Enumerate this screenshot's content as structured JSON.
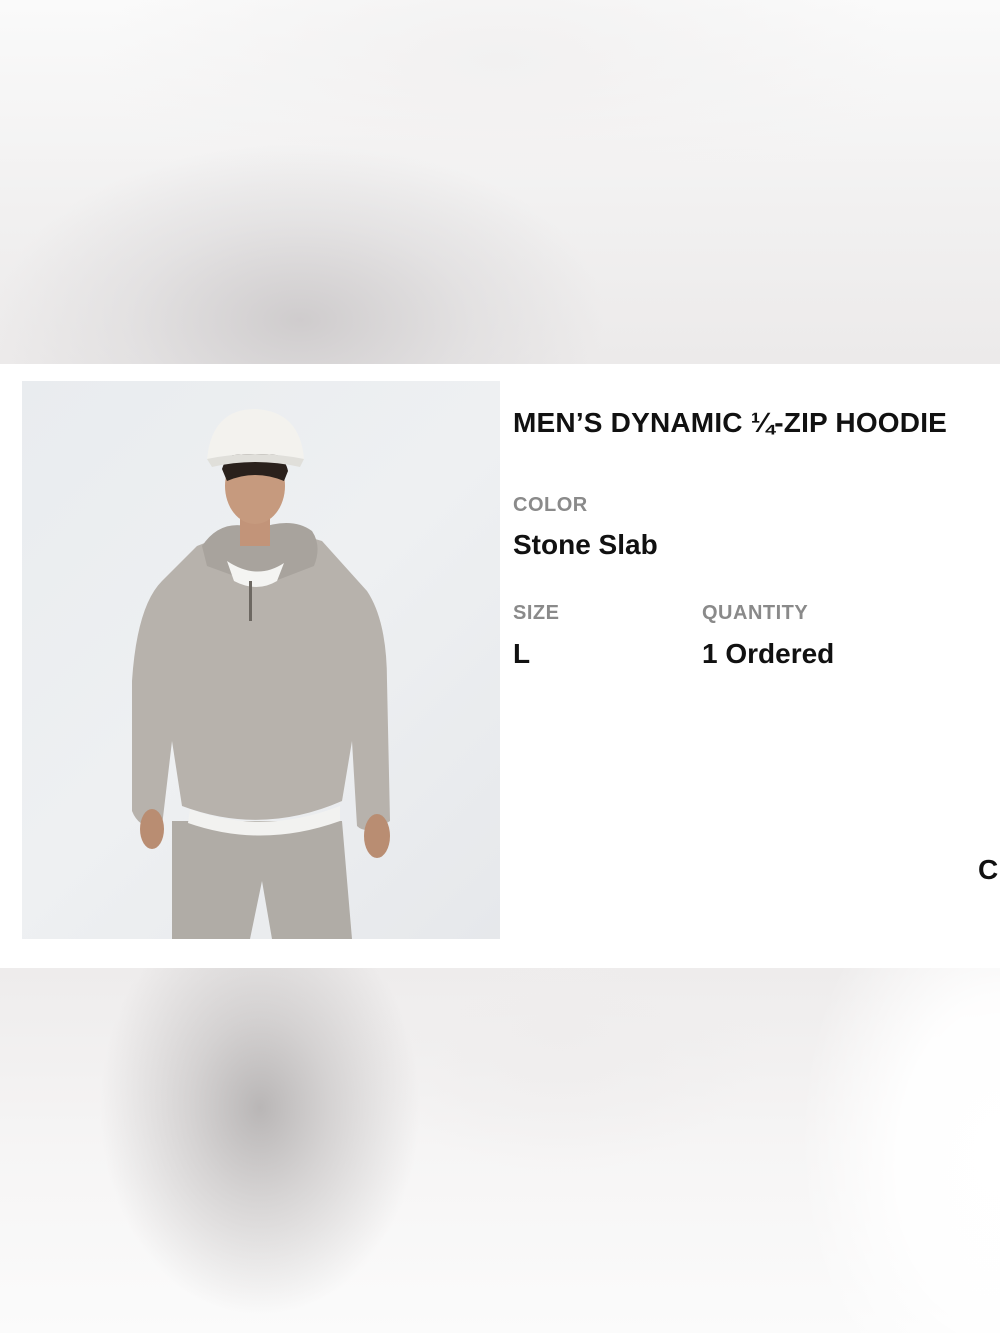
{
  "product": {
    "title": "MEN’S DYNAMIC ¼-ZIP HOODIE",
    "image_alt": "product-photo"
  },
  "color": {
    "label": "COLOR",
    "value": "Stone Slab"
  },
  "size": {
    "label": "SIZE",
    "value": "L"
  },
  "quantity": {
    "label": "QUANTITY",
    "value": "1 Ordered"
  },
  "truncated_text": "C",
  "colors": {
    "text": "#111111",
    "label": "#8a8a8a",
    "hoodie": "#b5b0aa",
    "background": "#ffffff"
  }
}
